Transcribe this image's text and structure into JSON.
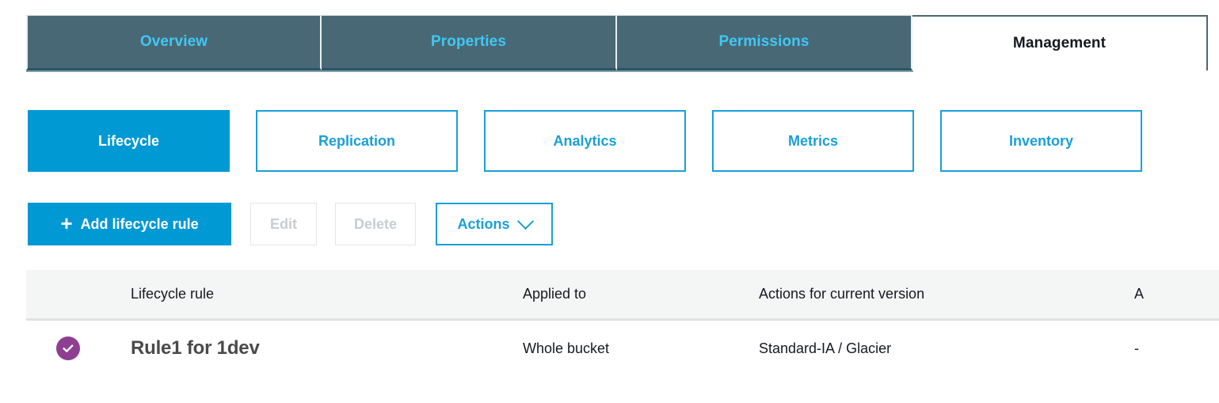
{
  "console_tabs": [
    {
      "label": "Overview",
      "active": false
    },
    {
      "label": "Properties",
      "active": false
    },
    {
      "label": "Permissions",
      "active": false
    },
    {
      "label": "Management",
      "active": true
    }
  ],
  "subtabs": [
    {
      "label": "Lifecycle",
      "selected": true
    },
    {
      "label": "Replication",
      "selected": false
    },
    {
      "label": "Analytics",
      "selected": false
    },
    {
      "label": "Metrics",
      "selected": false
    },
    {
      "label": "Inventory",
      "selected": false
    }
  ],
  "toolbar": {
    "add_rule_label": "Add lifecycle rule",
    "add_rule_icon": "plus-icon",
    "edit_label": "Edit",
    "edit_disabled": true,
    "delete_label": "Delete",
    "delete_disabled": true,
    "actions_label": "Actions",
    "actions_icon": "chevron-down-icon"
  },
  "table": {
    "headers": {
      "status": "",
      "rule": "Lifecycle rule",
      "applied_to": "Applied to",
      "actions_current": "Actions for current version",
      "actions_previous": "A"
    },
    "rows": [
      {
        "status_icon": "check-circle-icon",
        "rule": "Rule1 for 1dev",
        "applied_to": "Whole bucket",
        "actions_current": "Standard-IA / Glacier",
        "actions_previous": "-"
      }
    ]
  },
  "colors": {
    "tab_inactive_bg": "#496875",
    "tab_inactive_text": "#3fc8f4",
    "tab_active_text": "#16191f",
    "accent_blue": "#0099d4",
    "link_blue": "#1a9fd9",
    "status_purple": "#8e3f91",
    "table_header_bg": "#f4f5f5"
  }
}
